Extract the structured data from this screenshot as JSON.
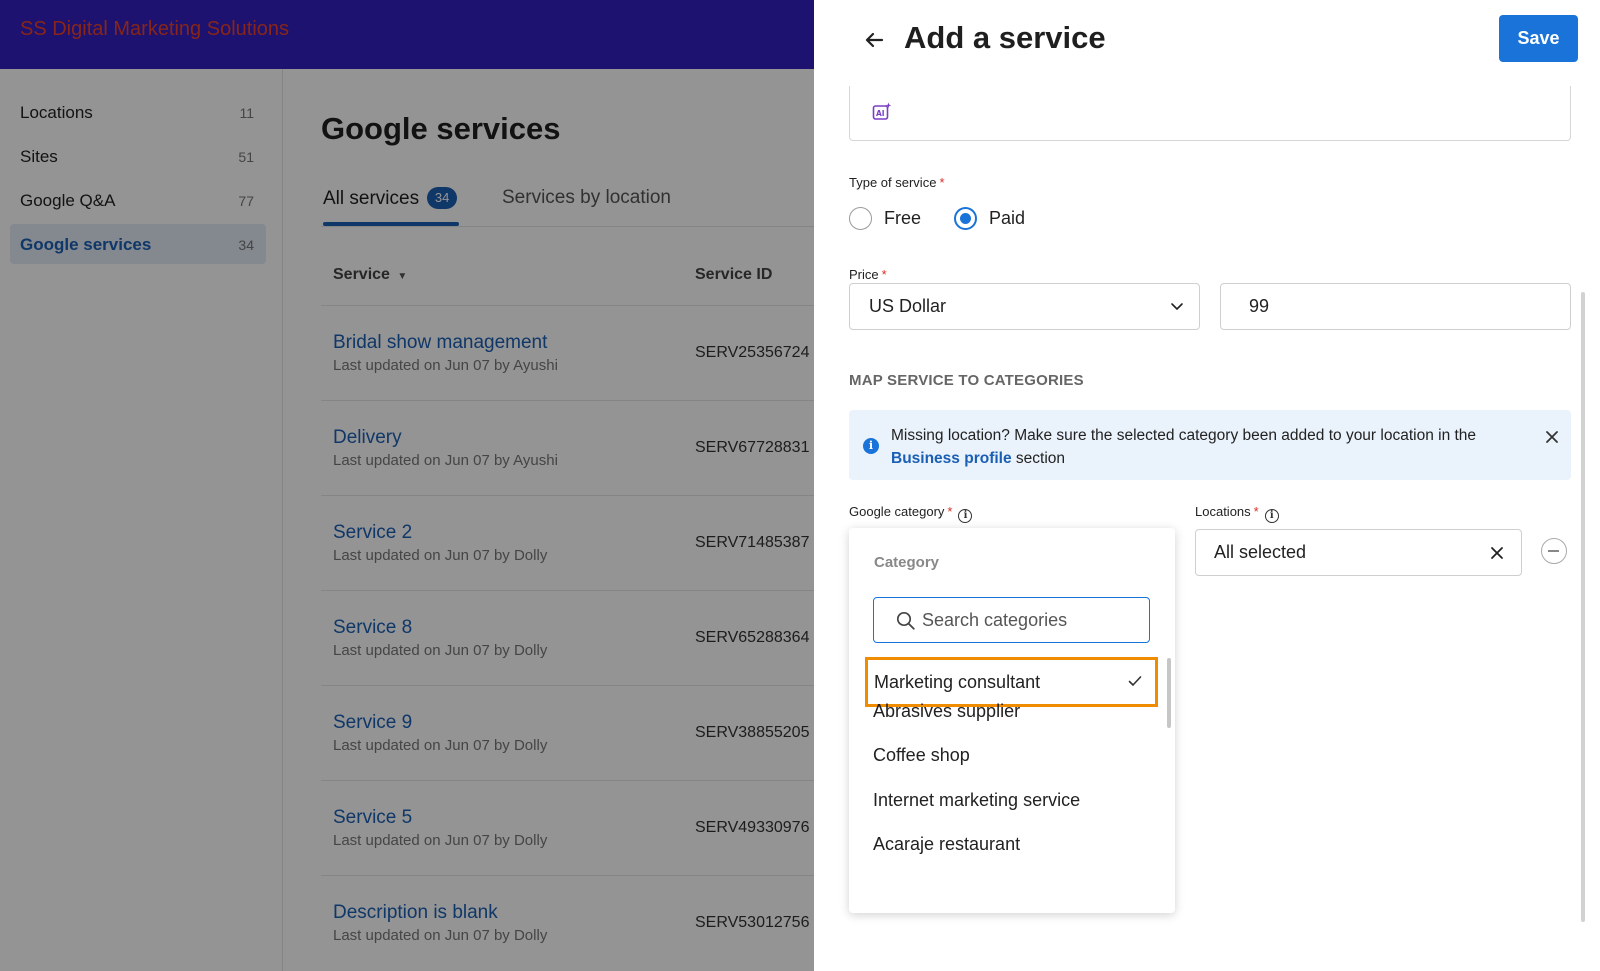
{
  "app": {
    "brand": "SS Digital Marketing Solutions"
  },
  "sidebar": {
    "items": [
      {
        "label": "Locations",
        "count": "11"
      },
      {
        "label": "Sites",
        "count": "51"
      },
      {
        "label": "Google Q&A",
        "count": "77"
      },
      {
        "label": "Google services",
        "count": "34"
      }
    ]
  },
  "main": {
    "title": "Google services",
    "tabs": [
      {
        "label": "All services",
        "badge": "34"
      },
      {
        "label": "Services by location"
      }
    ],
    "columns": [
      "Service",
      "Service ID"
    ],
    "rows": [
      {
        "name": "Bridal show management",
        "meta": "Last updated on Jun 07 by Ayushi",
        "id": "SERV25356724"
      },
      {
        "name": "Delivery",
        "meta": "Last updated on Jun 07 by Ayushi",
        "id": "SERV67728831"
      },
      {
        "name": "Service 2",
        "meta": "Last updated on Jun 07 by Dolly",
        "id": "SERV71485387"
      },
      {
        "name": "Service 8",
        "meta": "Last updated on Jun 07 by Dolly",
        "id": "SERV65288364"
      },
      {
        "name": "Service 9",
        "meta": "Last updated on Jun 07 by Dolly",
        "id": "SERV38855205"
      },
      {
        "name": "Service 5",
        "meta": "Last updated on Jun 07 by Dolly",
        "id": "SERV49330976"
      },
      {
        "name": "Description is blank",
        "meta": "Last updated on Jun 07 by Dolly",
        "id": "SERV53012756"
      }
    ]
  },
  "panel": {
    "title": "Add a service",
    "save_label": "Save",
    "type_label": "Type of service",
    "type_options": [
      "Free",
      "Paid"
    ],
    "type_selected": "Paid",
    "price_label": "Price",
    "currency": "US Dollar",
    "price_value": "99",
    "section_heading": "MAP SERVICE TO CATEGORIES",
    "alert": {
      "text": "Missing location? Make sure the selected category been added to your location in the",
      "link": "Business profile",
      "suffix": "section"
    },
    "category_label": "Google category",
    "locations_label": "Locations",
    "locations_value": "All selected",
    "required_mark": "*",
    "dropdown": {
      "heading": "Category",
      "search_placeholder": "Search categories",
      "options": [
        "Marketing consultant",
        "Abrasives supplier",
        "Coffee shop",
        "Internet marketing service",
        "Acaraje restaurant"
      ],
      "selected": "Marketing consultant"
    }
  },
  "colors": {
    "topbar": "#3320c0",
    "brand_text": "#e8402a",
    "accent": "#1a73d9",
    "highlight_border": "#f08c00"
  }
}
